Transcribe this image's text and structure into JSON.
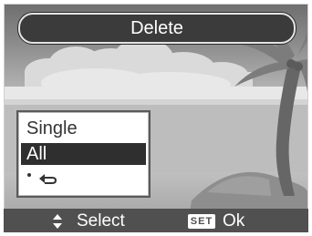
{
  "dialog": {
    "title": "Delete"
  },
  "menu": {
    "items": [
      {
        "label": "Single",
        "selected": false
      },
      {
        "label": "All",
        "selected": true
      },
      {
        "icon": "return-arrow-icon",
        "selected": false
      }
    ]
  },
  "status_bar": {
    "select_icon": "up-down-arrows-icon",
    "select_label": "Select",
    "ok_key": "SET",
    "ok_label": "Ok"
  },
  "colors": {
    "title_bar": "#3b3b3b",
    "selection": "#2f2f2f",
    "status_bar": "#505050"
  }
}
